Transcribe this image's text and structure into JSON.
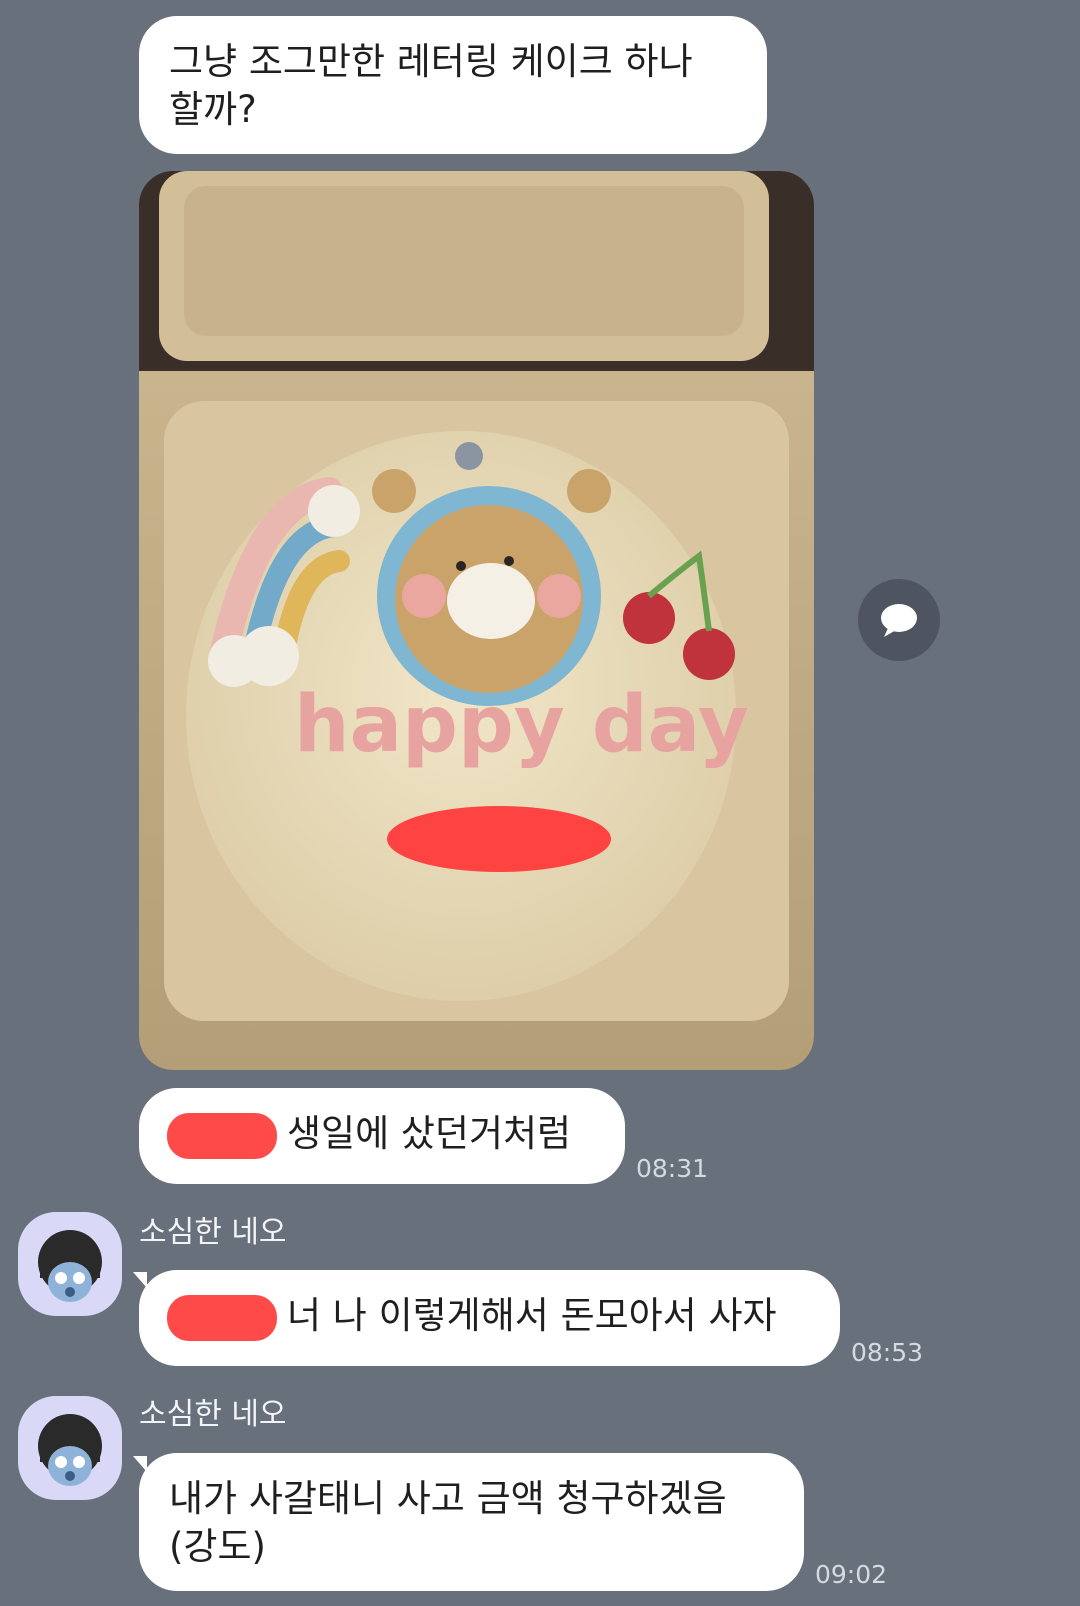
{
  "chat": {
    "msg1": {
      "text": "그냥 조그만한 레터링 케이크 하나\n할까?"
    },
    "photo": {
      "cake_text": "happy day"
    },
    "msg2": {
      "text": "생일에 샀던거처럼",
      "time": "08:31"
    },
    "msg3": {
      "sender": "소심한 네오",
      "text": "너 나 이렇게해서 돈모아서 사자",
      "time": "08:53"
    },
    "msg4": {
      "sender": "소심한 네오",
      "text": "내가 사갈태니 사고 금액 청구하겠음\n(강도)",
      "time": "09:02"
    }
  },
  "icons": {
    "share": "speech-bubble-icon",
    "avatar": "neo-character-icon"
  },
  "colors": {
    "background": "#68707c",
    "bubble": "#ffffff",
    "redaction": "#ff3b3b",
    "avatar_bg": "#d9d9f7"
  }
}
